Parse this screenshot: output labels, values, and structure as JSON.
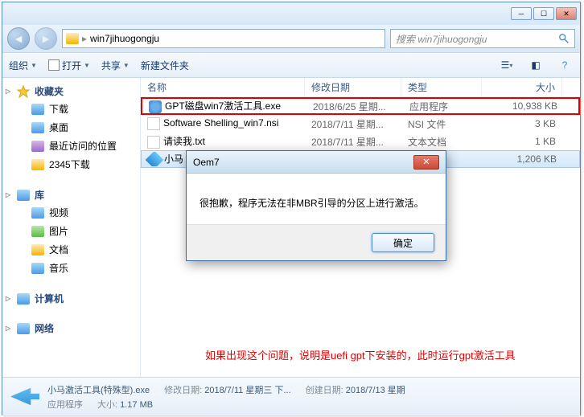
{
  "window": {
    "path_folder": "win7jihuogongju",
    "search_placeholder": "搜索 win7jihuogongju"
  },
  "toolbar": {
    "organize": "组织",
    "open": "打开",
    "share": "共享",
    "newfolder": "新建文件夹"
  },
  "sidebar": {
    "favorites": "收藏夹",
    "downloads": "下载",
    "desktop": "桌面",
    "recent": "最近访问的位置",
    "folder2345": "2345下载",
    "libraries": "库",
    "videos": "视频",
    "pictures": "图片",
    "documents": "文档",
    "music": "音乐",
    "computer": "计算机",
    "network": "网络"
  },
  "columns": {
    "name": "名称",
    "date": "修改日期",
    "type": "类型",
    "size": "大小"
  },
  "files": [
    {
      "name": "GPT磁盘win7激活工具.exe",
      "date": "2018/6/25 星期...",
      "type": "应用程序",
      "size": "10,938 KB",
      "icon": "exe",
      "highlighted": true
    },
    {
      "name": "Software Shelling_win7.nsi",
      "date": "2018/7/11 星期...",
      "type": "NSI 文件",
      "size": "3 KB",
      "icon": "nsi"
    },
    {
      "name": "请读我.txt",
      "date": "2018/7/11 星期...",
      "type": "文本文档",
      "size": "1 KB",
      "icon": "txt"
    },
    {
      "name": "小马",
      "date": "",
      "type": "",
      "size": "1,206 KB",
      "icon": "app",
      "selected": true
    }
  ],
  "annotation": "如果出现这个问题，说明是uefi gpt下安装的，此时运行gpt激活工具",
  "dialog": {
    "title": "Oem7",
    "message": "很抱歉，程序无法在非MBR引导的分区上进行激活。",
    "ok": "确定"
  },
  "statusbar": {
    "filename": "小马激活工具(特殊型).exe",
    "apptype": "应用程序",
    "modlabel": "修改日期:",
    "moddate": "2018/7/11 星期三 下...",
    "createlabel": "创建日期:",
    "createdate": "2018/7/13 星期",
    "sizelabel": "大小:",
    "size": "1.17 MB"
  }
}
